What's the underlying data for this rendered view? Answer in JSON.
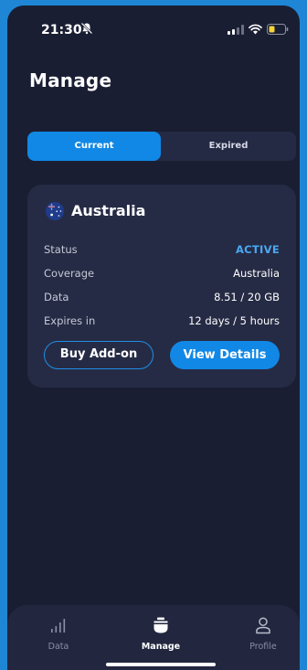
{
  "status_bar": {
    "time": "21:30"
  },
  "page": {
    "title": "Manage"
  },
  "tabs": [
    {
      "label": "Current"
    },
    {
      "label": "Expired"
    }
  ],
  "plan": {
    "country": "Australia",
    "rows": [
      {
        "label": "Status",
        "value": "ACTIVE"
      },
      {
        "label": "Coverage",
        "value": "Australia"
      },
      {
        "label": "Data",
        "value": "8.51 / 20 GB"
      },
      {
        "label": "Expires in",
        "value": "12 days / 5 hours"
      }
    ],
    "buy_addon_label": "Buy Add-on",
    "view_details_label": "View Details"
  },
  "nav": [
    {
      "label": "Data",
      "icon": "bar-chart-icon"
    },
    {
      "label": "Manage",
      "icon": "sim-stack-icon"
    },
    {
      "label": "Profile",
      "icon": "person-icon"
    }
  ],
  "colors": {
    "accent": "#1188e6",
    "background": "#1a1e33",
    "card": "#262b45",
    "active_status": "#4aa8f2"
  }
}
